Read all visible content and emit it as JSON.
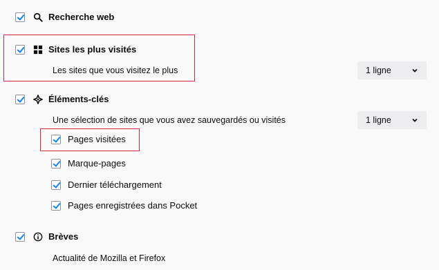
{
  "sections": {
    "web_search": {
      "label": "Recherche web",
      "checked": true
    },
    "top_sites": {
      "label": "Sites les plus visités",
      "description": "Les sites que vous visitez le plus",
      "rows_select": "1 ligne",
      "checked": true
    },
    "highlights": {
      "label": "Éléments-clés",
      "description": "Une sélection de sites que vous avez sauvegardés ou visités",
      "rows_select": "1 ligne",
      "checked": true,
      "options": [
        {
          "label": "Pages visitées",
          "checked": true
        },
        {
          "label": "Marque-pages",
          "checked": true
        },
        {
          "label": "Dernier téléchargement",
          "checked": true
        },
        {
          "label": "Pages enregistrées dans Pocket",
          "checked": true
        }
      ]
    },
    "snippets": {
      "label": "Brèves",
      "description": "Actualité de Mozilla et Firefox",
      "checked": true
    }
  },
  "colors": {
    "accent": "#0a84ff",
    "highlight_box": "#d7263d",
    "select_bg": "#ededf0"
  },
  "icons": {
    "web_search": "search-icon",
    "top_sites": "grid-icon",
    "highlights": "sparkle-icon",
    "snippets": "info-icon"
  }
}
